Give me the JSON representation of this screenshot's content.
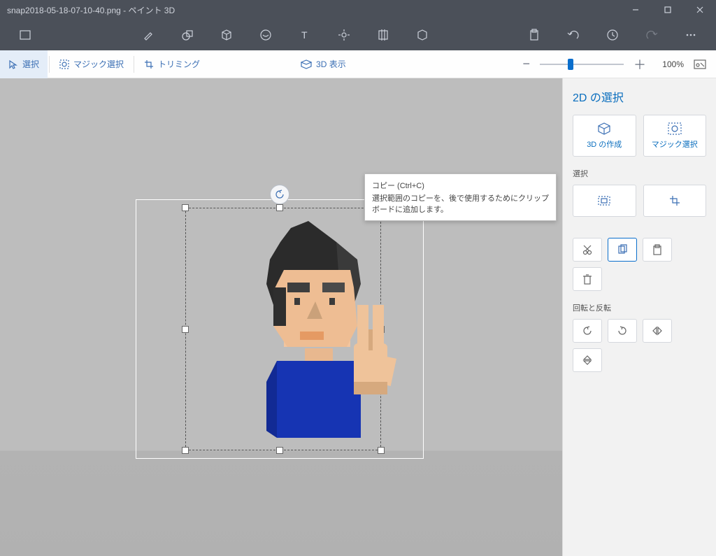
{
  "titlebar": {
    "title": "snap2018-05-18-07-10-40.png - ペイント 3D"
  },
  "optbar": {
    "select": "選択",
    "magic": "マジック選択",
    "trim": "トリミング",
    "view3d": "3D 表示",
    "zoom_pct": "100%"
  },
  "side": {
    "title": "2D の選択",
    "make3d": "3D の作成",
    "magic": "マジック選択",
    "sec_select": "選択",
    "sec_rotate": "回転と反転"
  },
  "tooltip": {
    "title": "コピー (Ctrl+C)",
    "body": "選択範囲のコピーを、後で使用するためにクリップボードに追加します。"
  }
}
